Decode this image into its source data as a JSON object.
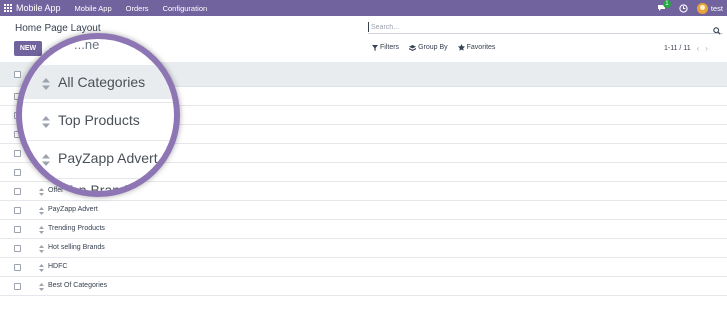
{
  "navbar": {
    "brand": "Mobile App",
    "menus": [
      "Mobile App",
      "Orders",
      "Configuration"
    ],
    "chat_badge": "1",
    "user_name": "test",
    "color": "#71639e"
  },
  "control_panel": {
    "breadcrumb": "Home Page Layout",
    "new_label": "NEW",
    "search_placeholder": "Search...",
    "filters_label": "Filters",
    "groupby_label": "Group By",
    "favorites_label": "Favorites",
    "pager": "1-11 / 11"
  },
  "magnifier": {
    "partial_header": "...ne",
    "items": [
      "All Categories",
      "Top Products",
      "PayZapp Advert",
      "Top Brands"
    ]
  },
  "rows": [
    {
      "name": ""
    },
    {
      "name": ""
    },
    {
      "name": ""
    },
    {
      "name": ""
    },
    {
      "name": ""
    },
    {
      "name": "Offer"
    },
    {
      "name": "PayZapp Advert"
    },
    {
      "name": "Trending Products"
    },
    {
      "name": "Hot selling Brands"
    },
    {
      "name": "HDFC"
    },
    {
      "name": "Best Of Categories"
    }
  ],
  "icons": [
    "apps-grid-icon",
    "chat-icon",
    "clock-icon",
    "download-icon",
    "search-icon",
    "filter-icon",
    "layers-icon",
    "star-icon",
    "drag-handle-icon"
  ]
}
